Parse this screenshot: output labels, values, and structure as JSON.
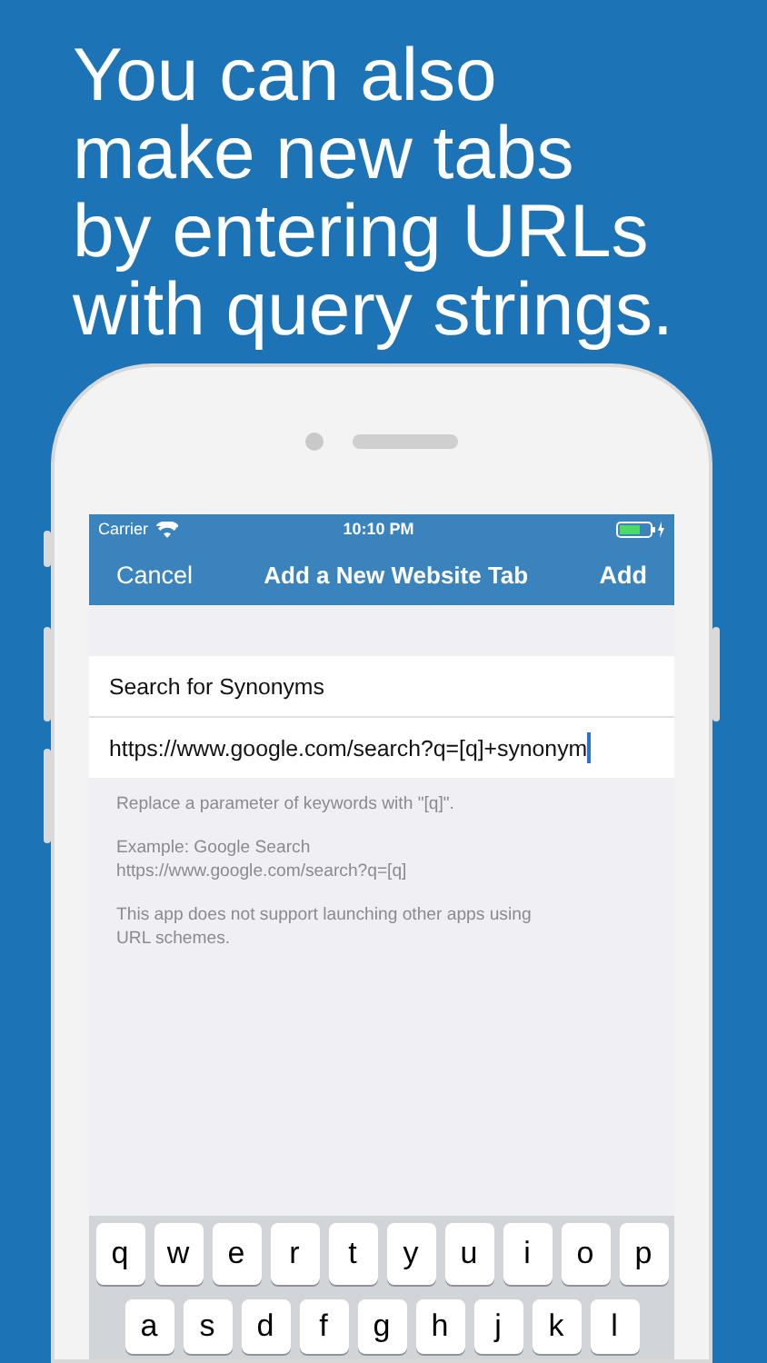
{
  "headline": "You can also\nmake new tabs\nby entering URLs\nwith query strings.",
  "status_bar": {
    "carrier": "Carrier",
    "time": "10:10 PM"
  },
  "nav": {
    "cancel": "Cancel",
    "title": "Add a New Website Tab",
    "add": "Add"
  },
  "form": {
    "name_value": "Search for Synonyms",
    "url_value": "https://www.google.com/search?q=[q]+synonym"
  },
  "notes": [
    "Replace a parameter of keywords with \"[q]\".",
    "Example: Google Search\nhttps://www.google.com/search?q=[q]",
    "This app does not support launching other apps using\nURL schemes."
  ],
  "keyboard": [
    [
      "q",
      "w",
      "e",
      "r",
      "t",
      "y",
      "u",
      "i",
      "o",
      "p"
    ],
    [
      "a",
      "s",
      "d",
      "f",
      "g",
      "h",
      "j",
      "k",
      "l"
    ]
  ]
}
